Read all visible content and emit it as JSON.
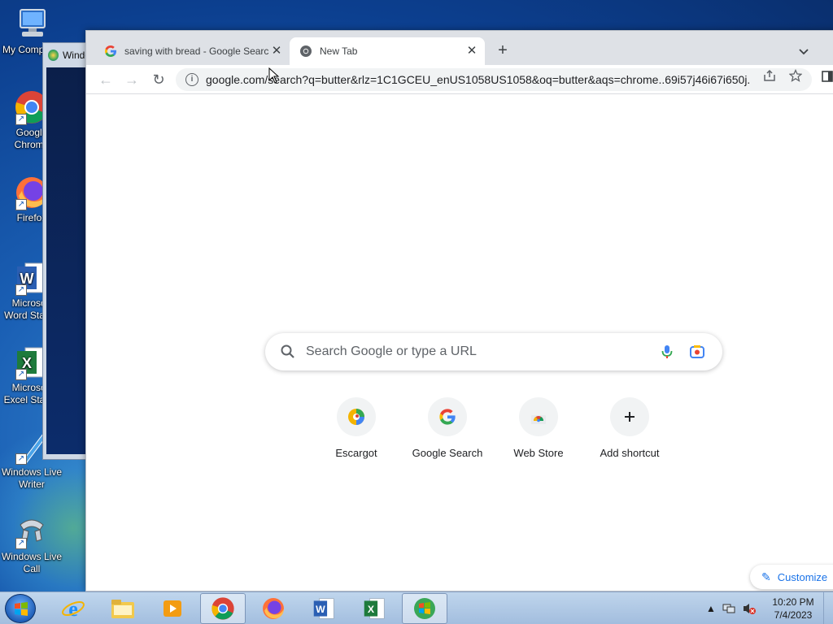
{
  "desktop": {
    "icons": [
      {
        "label": "My Computer",
        "icon": "computer-icon"
      },
      {
        "label": "Google Chrome",
        "icon": "chrome-icon"
      },
      {
        "label": "Firefox",
        "icon": "firefox-icon"
      },
      {
        "label": "Microsoft Word Starter",
        "icon": "word-icon"
      },
      {
        "label": "Microsoft Excel Starter",
        "icon": "excel-icon"
      },
      {
        "label": "Windows Live Writer",
        "icon": "writer-icon"
      },
      {
        "label": "Windows Live Call",
        "icon": "call-icon"
      }
    ],
    "bg_window_title": "Windo"
  },
  "browser": {
    "tabs": [
      {
        "title": "saving with bread - Google Search",
        "icon": "google-icon",
        "active": false
      },
      {
        "title": "New Tab",
        "icon": "chrome-icon",
        "active": true
      }
    ],
    "new_tab_symbol": "+",
    "tab_close_symbol": "✕",
    "toolbar": {
      "back_symbol": "←",
      "forward_symbol": "→",
      "reload_symbol": "↻",
      "url": "google.com/search?q=butter&rlz=1C1GCEU_enUS1058US1058&oq=butter&aqs=chrome..69i57j46i67i650j..."
    },
    "page": {
      "search_placeholder": "Search Google or type a URL",
      "shortcuts": [
        {
          "label": "Escargot",
          "icon": "escargot-icon"
        },
        {
          "label": "Google Search",
          "icon": "google-icon"
        },
        {
          "label": "Web Store",
          "icon": "web-store-icon"
        },
        {
          "label": "Add shortcut",
          "icon": "plus-icon"
        }
      ],
      "customize_label": "Customize"
    }
  },
  "taskbar": {
    "apps": [
      "explorer-icon",
      "ie-icon",
      "file-explorer-icon",
      "media-player-icon",
      "chrome-icon",
      "firefox-icon",
      "word-icon",
      "excel-icon",
      "windows-icon"
    ],
    "clock_time": "10:20 PM",
    "clock_date": "7/4/2023"
  },
  "colors": {
    "accent": "#1a73e8",
    "tabstrip": "#dee1e6",
    "omnibox": "#f1f3f4"
  }
}
